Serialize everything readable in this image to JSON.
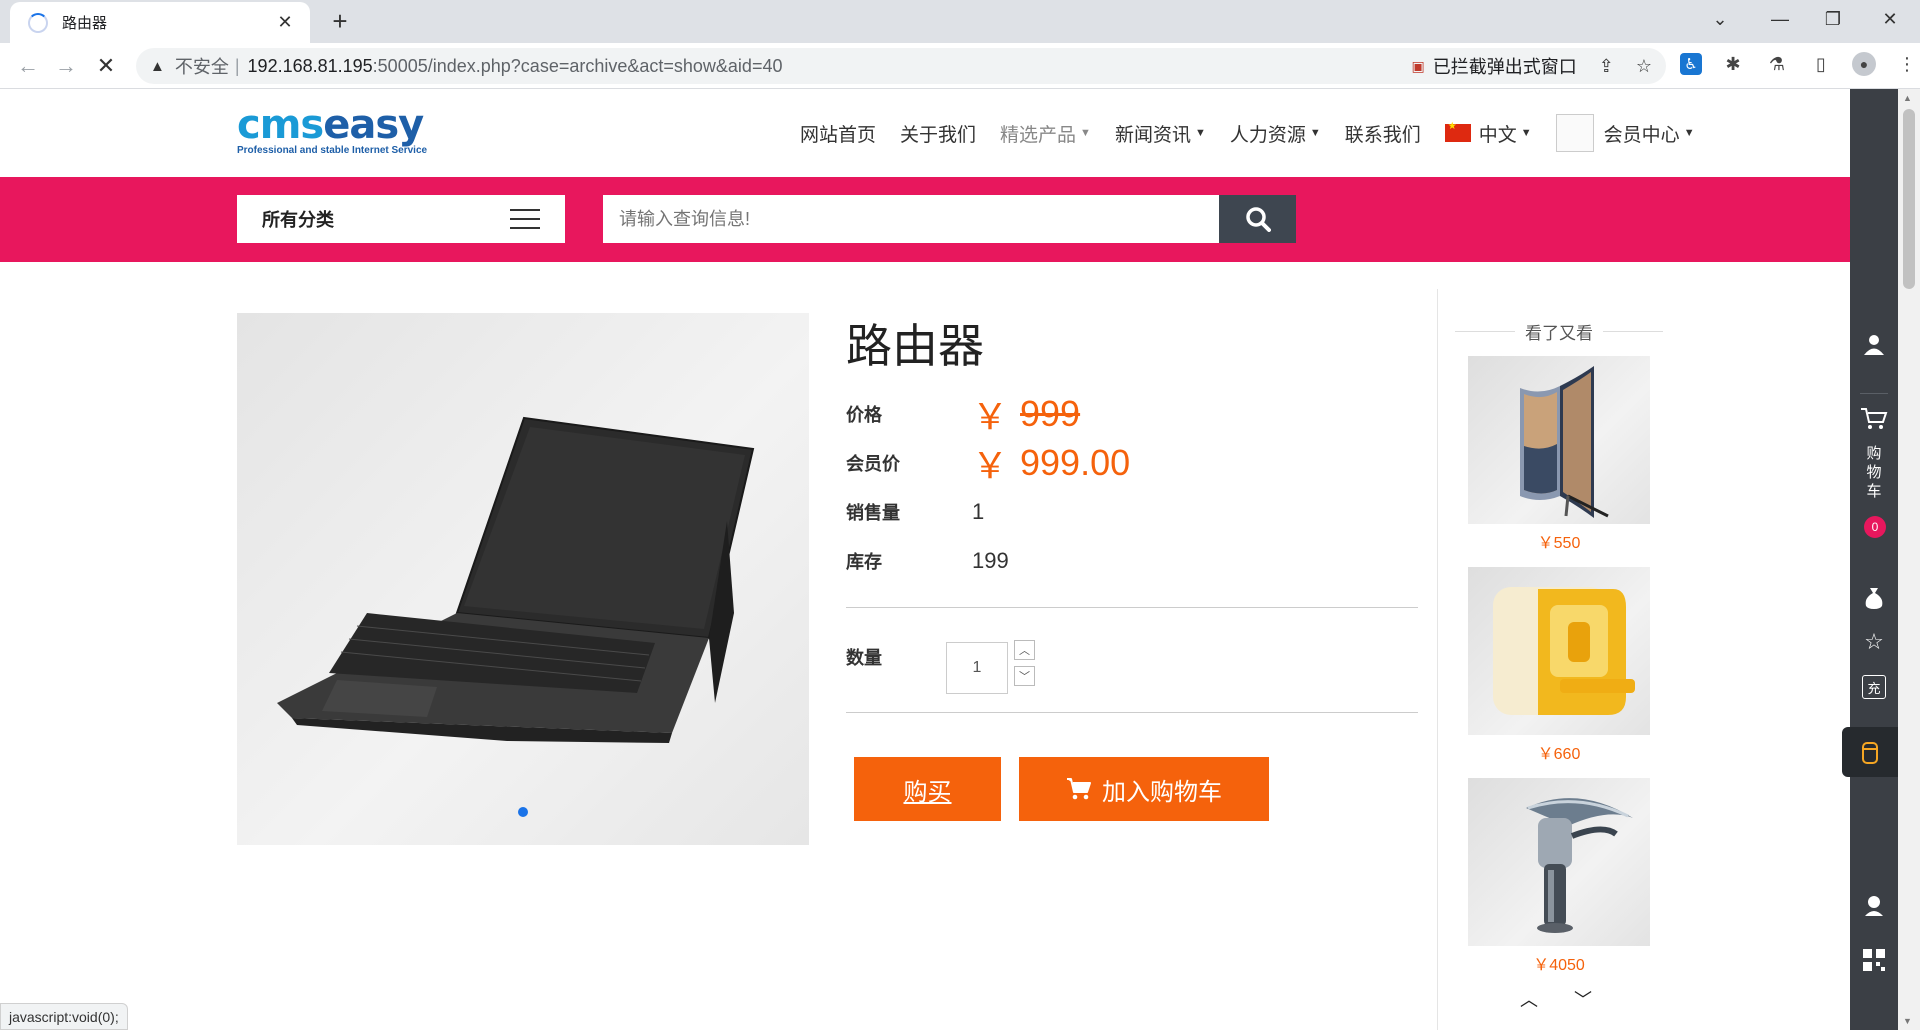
{
  "browser": {
    "tab_title": "路由器",
    "address": {
      "insecure_label": "不安全",
      "separator": "|",
      "host": "192.168.81.195",
      "path": ":50005/index.php?case=archive&act=show&aid=40"
    },
    "popup_blocked_label": "已拦截弹出式窗口",
    "status_text": "javascript:void(0);"
  },
  "header": {
    "logo_part1": "cms",
    "logo_part2": "easy",
    "logo_slogan": "Professional and stable Internet Service",
    "nav": [
      {
        "label": "网站首页"
      },
      {
        "label": "关于我们"
      },
      {
        "label": "精选产品"
      },
      {
        "label": "新闻资讯"
      },
      {
        "label": "人力资源"
      },
      {
        "label": "联系我们"
      },
      {
        "label": "中文"
      },
      {
        "label": "会员中心"
      }
    ]
  },
  "search": {
    "category_label": "所有分类",
    "placeholder": "请输入查询信息!"
  },
  "product": {
    "title": "路由器",
    "price_label": "价格",
    "currency": "￥",
    "price": "999",
    "member_price_label": "会员价",
    "member_price": "999.00",
    "sales_label": "销售量",
    "sales": "1",
    "stock_label": "库存",
    "stock": "199",
    "quantity_label": "数量",
    "quantity": "1",
    "buy_label": "购买",
    "add_cart_label": "加入购物车"
  },
  "recommended": {
    "heading": "看了又看",
    "items": [
      {
        "price": "￥550"
      },
      {
        "price": "￥660"
      },
      {
        "price": "￥4050"
      }
    ]
  },
  "sidebar": {
    "cart_label": "购\n物\n车",
    "cart_count": "0",
    "recharge_label": "充"
  },
  "colors": {
    "accent_pink": "#e8175d",
    "accent_orange": "#f5620c",
    "sidebar_dark": "#3b3f45"
  }
}
